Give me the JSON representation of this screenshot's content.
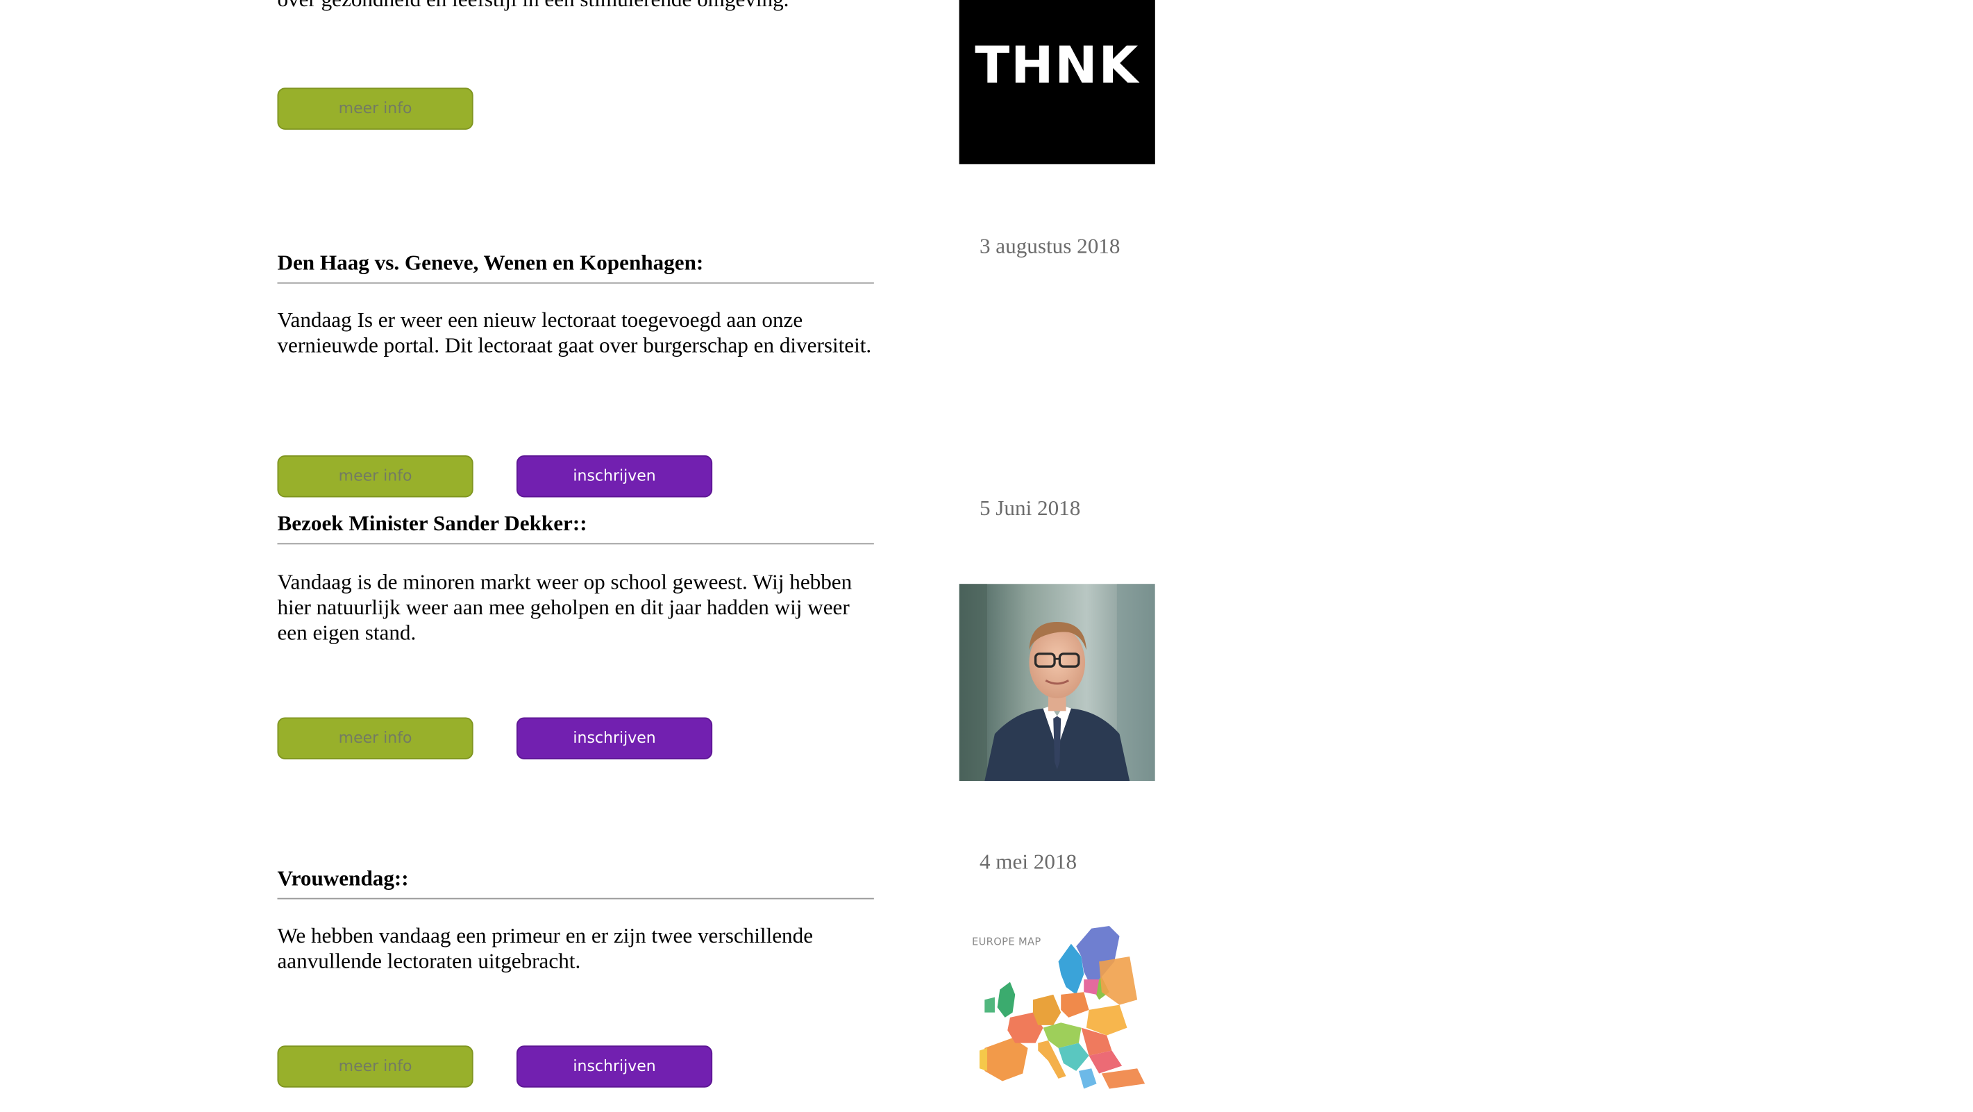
{
  "intro": {
    "text": "over gezondheid en leefstijl in een stimulerende omgeving."
  },
  "buttons": {
    "info_label": "meer info",
    "subscribe_label": "inschrijven"
  },
  "logo": {
    "text": "THNK"
  },
  "posts": [
    {
      "title": "Den Haag vs. Geneve, Wenen en Kopenhagen:",
      "body": "Vandaag Is er weer een nieuw lectoraat toegevoegd aan onze vernieuwde portal. Dit lectoraat gaat over burgerschap en diversiteit.",
      "date": "3 augustus 2018"
    },
    {
      "title": "Bezoek Minister Sander Dekker::",
      "body": "Vandaag is de minoren markt weer op school geweest. Wij hebben hier natuurlijk weer aan mee geholpen en dit jaar hadden wij weer een eigen stand.",
      "date": "5 Juni 2018"
    },
    {
      "title": "Vrouwendag::",
      "body": "We hebben vandaag een primeur en er zijn twee verschillende aanvullende lectoraten uitgebracht.",
      "date": "4 mei 2018"
    }
  ],
  "map": {
    "title": "EUROPE MAP"
  },
  "colors": {
    "info_button": "#98b02b",
    "subscribe_button": "#7220b0",
    "date_text": "#6b6b6b",
    "divider": "#9a9a9a"
  },
  "images": {
    "logo": "thnk-logo",
    "portrait": "minister-portrait-photo",
    "map": "europe-map-image"
  }
}
